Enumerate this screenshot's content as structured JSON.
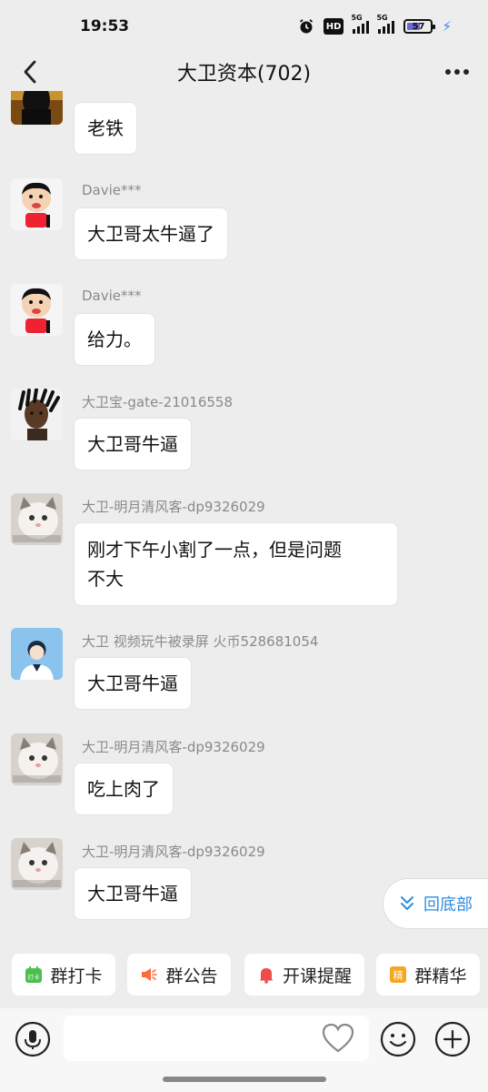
{
  "status_bar": {
    "time": "19:53",
    "hd_label": "HD",
    "signal1_label": "5G",
    "signal2_label": "5G",
    "battery_level": "57",
    "icons": [
      "alarm-icon",
      "hd-icon",
      "signal-icon",
      "signal-icon",
      "battery-icon",
      "charging-bolt-icon"
    ]
  },
  "header": {
    "title": "大卫资本(702)",
    "back_icon": "chevron-left-icon",
    "more_icon": "more-dots-icon"
  },
  "messages": [
    {
      "sender": "",
      "text": "老铁",
      "avatar": "dark-person-avatar"
    },
    {
      "sender": "Davie***",
      "text": "大卫哥太牛逼了",
      "avatar": "cartoon-boy-avatar"
    },
    {
      "sender": "Davie***",
      "text": "给力。",
      "avatar": "cartoon-boy-avatar"
    },
    {
      "sender": "大卫宝-gate-21016558",
      "text": "大卫哥牛逼",
      "avatar": "dreadlocks-person-avatar"
    },
    {
      "sender": "大卫-明月清风客-dp9326029",
      "text_line1": "刚才下午小割了一点，但是问题",
      "text_line2": "不大",
      "avatar": "cat-avatar"
    },
    {
      "sender": "大卫 视频玩牛被录屏 火币528681054",
      "text": "大卫哥牛逼",
      "avatar": "default-user-avatar"
    },
    {
      "sender": "大卫-明月清风客-dp9326029",
      "text": "吃上肉了",
      "avatar": "cat-avatar"
    },
    {
      "sender": "大卫-明月清风客-dp9326029",
      "text": "大卫哥牛逼",
      "avatar": "cat-avatar"
    }
  ],
  "scroll_to_bottom": {
    "label": "回底部",
    "icon": "double-chevron-down-icon"
  },
  "quick_actions": [
    {
      "label": "群打卡",
      "icon": "calendar-checkin-icon",
      "icon_text": "打卡",
      "color": "#4cbf4c"
    },
    {
      "label": "群公告",
      "icon": "megaphone-icon",
      "color": "#ff6a3d"
    },
    {
      "label": "开课提醒",
      "icon": "bell-icon",
      "color": "#f04b4b"
    },
    {
      "label": "群精华",
      "icon": "essence-badge-icon",
      "icon_text": "精",
      "color": "#f5a623"
    }
  ],
  "input_bar": {
    "placeholder": "",
    "icons": [
      "voice-icon",
      "heart-icon",
      "emoji-icon",
      "add-icon"
    ]
  },
  "colors": {
    "background": "#ededed",
    "bubble": "#ffffff",
    "accent_blue": "#2d8cdf",
    "sender_gray": "#8a8a8a"
  }
}
